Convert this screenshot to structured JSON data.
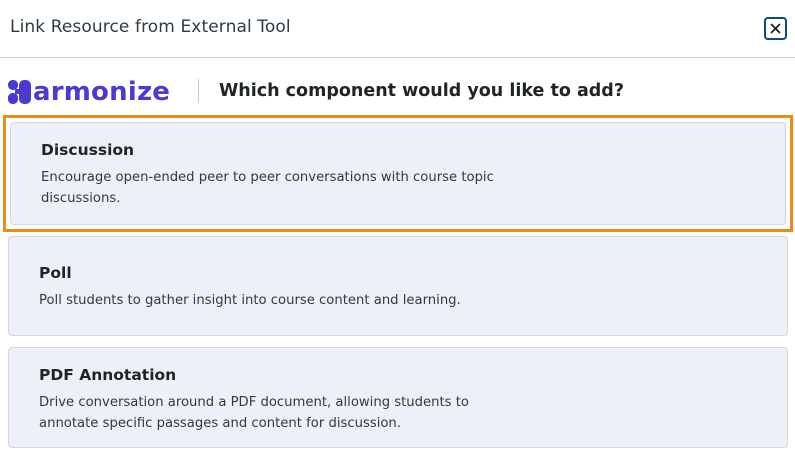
{
  "modal": {
    "title": "Link Resource from External Tool",
    "close_label": "Close"
  },
  "brand": {
    "name": "armonize",
    "question": "Which component would you like to add?",
    "accent_color": "#4a3ad2"
  },
  "options": [
    {
      "title": "Discussion",
      "description": "Encourage open-ended peer to peer conversations with course topic discussions.",
      "selected": true
    },
    {
      "title": "Poll",
      "description": "Poll students to gather insight into course content and learning.",
      "selected": false
    },
    {
      "title": "PDF Annotation",
      "description": "Drive conversation around a PDF document, allowing students to annotate specific passages and content for discussion.",
      "selected": false
    }
  ],
  "colors": {
    "selection_outline": "#f28a16",
    "card_background": "#edf0f7",
    "close_border": "#0e4a7d"
  }
}
